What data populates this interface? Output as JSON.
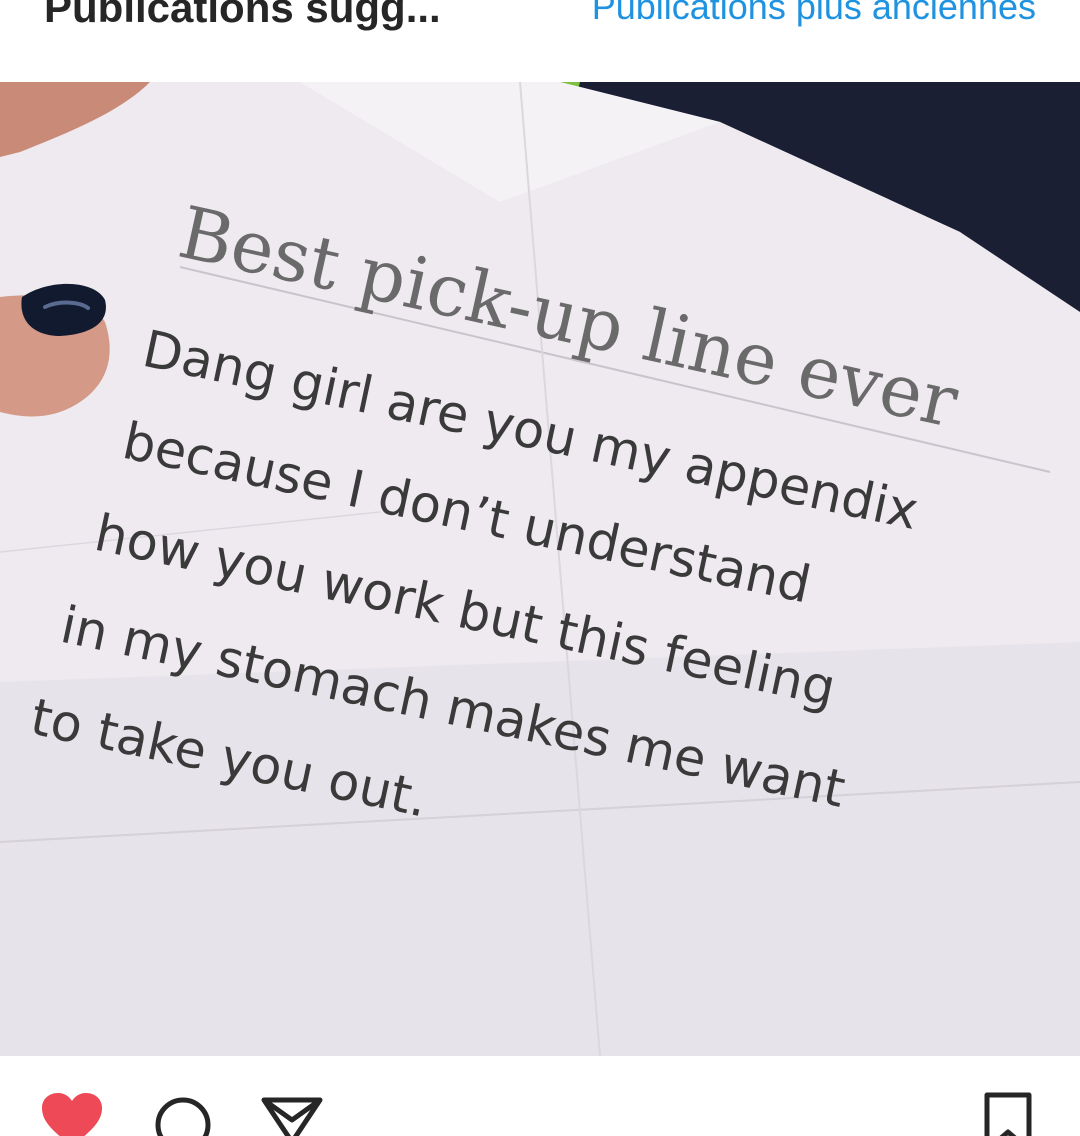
{
  "header": {
    "title": "Publications sugg...",
    "older_link": "Publications plus anciennes"
  },
  "post": {
    "note": {
      "title": "Best pick-up line ever",
      "lines": [
        "Dang girl are you my appendix",
        "because I don’t understand",
        "how you work but this feeling",
        "in my stomach makes me want",
        "to take you out."
      ]
    }
  },
  "actions": {
    "like_icon": "heart-icon",
    "comment_icon": "comment-icon",
    "share_icon": "send-icon",
    "save_icon": "bookmark-icon",
    "liked": true
  },
  "colors": {
    "link": "#1f93e0",
    "liked_heart": "#ed4956",
    "title_text": "#262626"
  }
}
